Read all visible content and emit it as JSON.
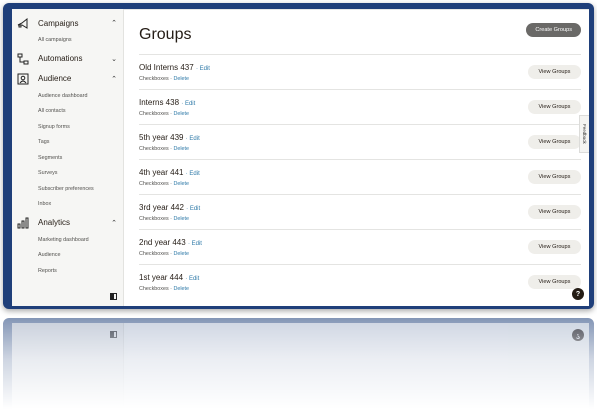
{
  "sidebar": {
    "sections": [
      {
        "label": "Campaigns",
        "icon": "campaigns-icon",
        "expanded": true,
        "items": [
          "All campaigns"
        ]
      },
      {
        "label": "Automations",
        "icon": "automations-icon",
        "expanded": false,
        "items": []
      },
      {
        "label": "Audience",
        "icon": "audience-icon",
        "expanded": true,
        "items": [
          "Audience dashboard",
          "All contacts",
          "Signup forms",
          "Tags",
          "Segments",
          "Surveys",
          "Subscriber preferences",
          "Inbox"
        ]
      },
      {
        "label": "Analytics",
        "icon": "analytics-icon",
        "expanded": true,
        "items": [
          "Marketing dashboard",
          "Audience",
          "Reports"
        ]
      }
    ]
  },
  "main": {
    "title": "Groups",
    "create_label": "Create Groups",
    "view_label": "View Groups",
    "edit_label": "Edit",
    "sub_checkboxes": "Checkboxes",
    "sub_delete": "Delete",
    "groups": [
      "Old Interns 437",
      "Interns 438",
      "5th year 439",
      "4th year 441",
      "3rd year 442",
      "2nd year 443",
      "1st year 444"
    ]
  },
  "feedback_label": "Feedback",
  "help_label": "?",
  "colors": {
    "frame": "#1f3f7a",
    "link": "#2f7aa8",
    "create_button": "#6a6967",
    "view_button": "#efeeea"
  }
}
